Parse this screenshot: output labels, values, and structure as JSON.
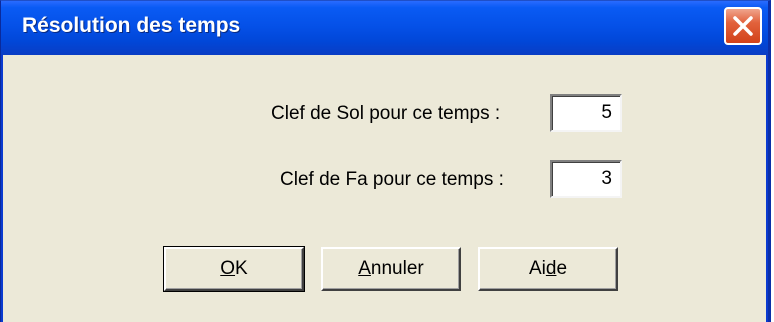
{
  "window": {
    "title": "Résolution des temps"
  },
  "fields": [
    {
      "label": "Clef de Sol pour ce temps :",
      "value": "5"
    },
    {
      "label": "Clef de Fa pour ce temps :",
      "value": "3"
    }
  ],
  "buttons": {
    "ok": {
      "pre": "",
      "mnemonic": "O",
      "post": "K"
    },
    "cancel": {
      "pre": "",
      "mnemonic": "A",
      "post": "nnuler"
    },
    "help": {
      "pre": "Ai",
      "mnemonic": "d",
      "post": "e"
    }
  },
  "icons": {
    "close": "close-icon"
  },
  "colors": {
    "titlebar": "#0551e8",
    "close_button": "#e2623c",
    "dialog_background": "#ece9d8"
  }
}
